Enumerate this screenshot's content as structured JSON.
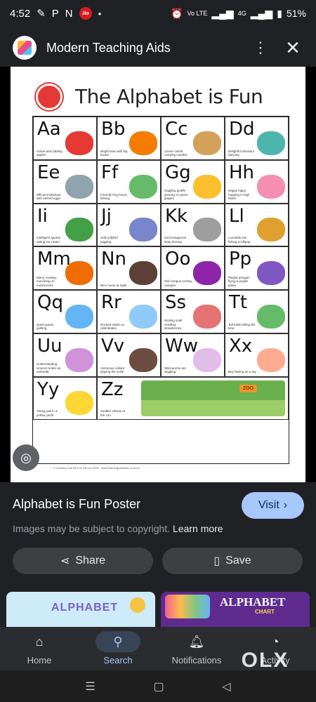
{
  "status_bar": {
    "time": "4:52",
    "carrier_badge": "Jio",
    "battery": "51%",
    "icons": [
      "lock-icon",
      "p-app-icon",
      "n-app-icon",
      "jio-icon",
      "alarm-icon",
      "volte-icon",
      "signal-icon",
      "4g-icon",
      "battery-icon"
    ]
  },
  "header": {
    "site_name": "Modern Teaching Aids",
    "menu_icon": "more-vert-icon",
    "close_icon": "close-icon"
  },
  "poster": {
    "title": "The Alphabet is Fun",
    "cells": [
      {
        "letters": "Aa",
        "desc": "Active ants adding apples",
        "color": "#e53935"
      },
      {
        "letters": "Bb",
        "desc": "Bright bear with big books",
        "color": "#f57c00"
      },
      {
        "letters": "Cc",
        "desc": "Clever camel carrying candles",
        "color": "#d4a15a"
      },
      {
        "letters": "Dd",
        "desc": "Delightful dinosaur dancing",
        "color": "#4db6ac"
      },
      {
        "letters": "Ee",
        "desc": "Efficient elephant with etched eggs",
        "color": "#90a4ae"
      },
      {
        "letters": "Ff",
        "desc": "Friendly frog found fishing",
        "color": "#66bb6a"
      },
      {
        "letters": "Gg",
        "desc": "Giggling giraffe grazing on green grapes",
        "color": "#fbc02d"
      },
      {
        "letters": "Hh",
        "desc": "Happy hippo hopping in high heels",
        "color": "#f48fb1"
      },
      {
        "letters": "Ii",
        "desc": "Intelligent iguana eating ice cream",
        "color": "#43a047"
      },
      {
        "letters": "Jj",
        "desc": "Jelly jellyfish juggling",
        "color": "#7986cb"
      },
      {
        "letters": "Kk",
        "desc": "Kind kangaroos keep kissing",
        "color": "#9e9e9e"
      },
      {
        "letters": "Ll",
        "desc": "Loveable lion licking a lollipop",
        "color": "#e0a030"
      },
      {
        "letters": "Mm",
        "desc": "Merry monkey munching on mushrooms",
        "color": "#ef6c00"
      },
      {
        "letters": "Nn",
        "desc": "Nice nurse at night",
        "color": "#5d4037"
      },
      {
        "letters": "Oo",
        "desc": "Old octopus sorting oranges",
        "color": "#8e24aa"
      },
      {
        "letters": "Pp",
        "desc": "Playful penguin flying a purple plane",
        "color": "#7e57c2"
      },
      {
        "letters": "Qq",
        "desc": "Quiet queen quilting",
        "color": "#64b5f6"
      },
      {
        "letters": "Rr",
        "desc": "Rocked rabbit on rollerskates",
        "color": "#90caf9"
      },
      {
        "letters": "Ss",
        "desc": "Smiling snail smelling strawberries",
        "color": "#e57373"
      },
      {
        "letters": "Tt",
        "desc": "Tall turtle telling the time",
        "color": "#66bb6a"
      },
      {
        "letters": "Uu",
        "desc": "Understanding Unicorn under an umbrella",
        "color": "#ce93d8"
      },
      {
        "letters": "Vv",
        "desc": "Victorious vulture playing the violin",
        "color": "#6d4c41"
      },
      {
        "letters": "Ww",
        "desc": "Wild worms are wiggling",
        "color": "#e1bee7"
      },
      {
        "letters": "Xx",
        "desc": "Boy having an x-ray",
        "color": "#ffab91"
      },
      {
        "letters": "Yy",
        "desc": "Young yak in a yellow yacht",
        "color": "#fdd835"
      }
    ],
    "z_cell": {
      "letters": "Zz",
      "desc": "Zoddier zebras at the zoo",
      "sign": "ZOO"
    },
    "footer": "© Learning Can Be Fun Pty Ltd 2015 · www.learningcanbefun.com.au"
  },
  "result": {
    "title": "Alphabet is Fun Poster",
    "visit_label": "Visit",
    "copyright_text": "Images may be subject to copyright.",
    "learn_more": "Learn more",
    "share_label": "Share",
    "save_label": "Save"
  },
  "related": [
    {
      "title": "ALPHABET"
    },
    {
      "title": "ALPHABET",
      "subtitle": "CHART"
    }
  ],
  "bottom_nav": [
    {
      "label": "Home",
      "icon": "home-icon",
      "active": false
    },
    {
      "label": "Search",
      "icon": "search-icon",
      "active": true
    },
    {
      "label": "Notifications",
      "icon": "bell-icon",
      "active": false
    },
    {
      "label": "Activity",
      "icon": "activity-icon",
      "active": false
    }
  ],
  "watermark": "OLX"
}
